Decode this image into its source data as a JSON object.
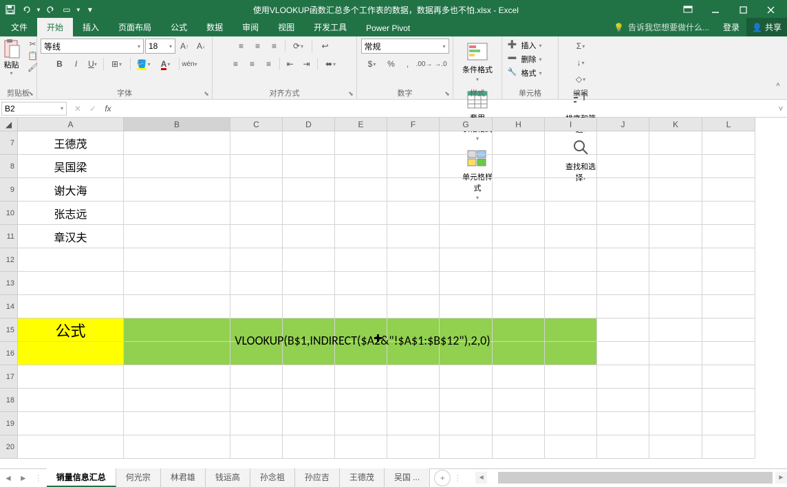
{
  "titlebar": {
    "title": "使用VLOOKUP函数汇总多个工作表的数据，数据再多也不怕.xlsx - Excel"
  },
  "tabs": {
    "file": "文件",
    "home": "开始",
    "insert": "插入",
    "layout": "页面布局",
    "formulas": "公式",
    "data": "数据",
    "review": "审阅",
    "view": "视图",
    "developer": "开发工具",
    "powerpivot": "Power Pivot",
    "tellme": "告诉我您想要做什么...",
    "signin": "登录",
    "share": "共享"
  },
  "ribbon": {
    "clipboard": {
      "paste": "粘贴",
      "label": "剪贴板"
    },
    "font": {
      "name": "等线",
      "size": "18",
      "label": "字体"
    },
    "alignment": {
      "label": "对齐方式"
    },
    "number": {
      "format": "常规",
      "label": "数字"
    },
    "styles": {
      "cond": "条件格式",
      "table": "套用\n表格格式",
      "cell": "单元格样式",
      "label": "样式"
    },
    "cells": {
      "insert": "插入",
      "delete": "删除",
      "format": "格式",
      "label": "单元格"
    },
    "editing": {
      "sort": "排序和筛选",
      "find": "查找和选择",
      "label": "编辑"
    }
  },
  "namebox": "B2",
  "formula": "",
  "columns": [
    "A",
    "B",
    "C",
    "D",
    "E",
    "F",
    "G",
    "H",
    "I",
    "J",
    "K",
    "L"
  ],
  "rows": [
    "7",
    "8",
    "9",
    "10",
    "11",
    "12",
    "13",
    "14",
    "15",
    "16",
    "17",
    "18",
    "19",
    "20"
  ],
  "cells": {
    "A7": "王德茂",
    "A8": "吴国梁",
    "A9": "谢大海",
    "A10": "张志远",
    "A11": "章汉夫",
    "A15": "公式",
    "formula_display": "VLOOKUP(B$1,INDIRECT($A2&\"!$A$1:$B$12\"),2,0)"
  },
  "sheets": {
    "active": "销量信息汇总",
    "tabs": [
      "销量信息汇总",
      "何光宗",
      "林君雄",
      "钱运高",
      "孙念祖",
      "孙应吉",
      "王德茂",
      "吴国 ..."
    ]
  }
}
